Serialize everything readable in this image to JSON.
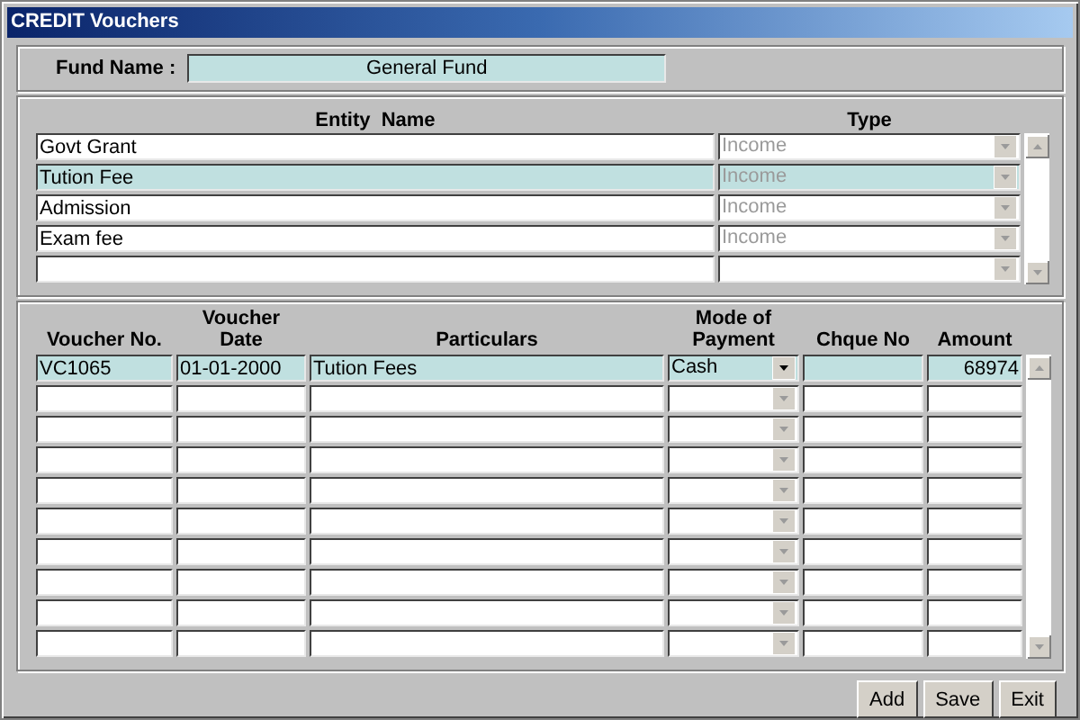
{
  "window": {
    "title": "CREDIT Vouchers"
  },
  "fund": {
    "label": "Fund Name :",
    "value": "General Fund"
  },
  "entities": {
    "columns": [
      "Entity  Name",
      "Type"
    ],
    "rows": [
      {
        "name": "Govt Grant",
        "type": "Income",
        "selected": false,
        "type_disabled": true
      },
      {
        "name": "Tution Fee",
        "type": "Income",
        "selected": true,
        "type_disabled": true
      },
      {
        "name": "Admission",
        "type": "Income",
        "selected": false,
        "type_disabled": true
      },
      {
        "name": "Exam fee",
        "type": "Income",
        "selected": false,
        "type_disabled": true
      }
    ]
  },
  "vouchers": {
    "columns": [
      "Voucher No.",
      "Voucher\nDate",
      "Particulars",
      "Mode of\nPayment",
      "Chque No",
      "Amount"
    ],
    "rows": [
      {
        "voucher_no": "VC1065",
        "date": "01-01-2000",
        "particulars": "Tution Fees",
        "mode": "Cash",
        "amount": "68974",
        "selected": true
      }
    ]
  },
  "buttons": [
    "Add",
    "Save",
    "Exit"
  ]
}
